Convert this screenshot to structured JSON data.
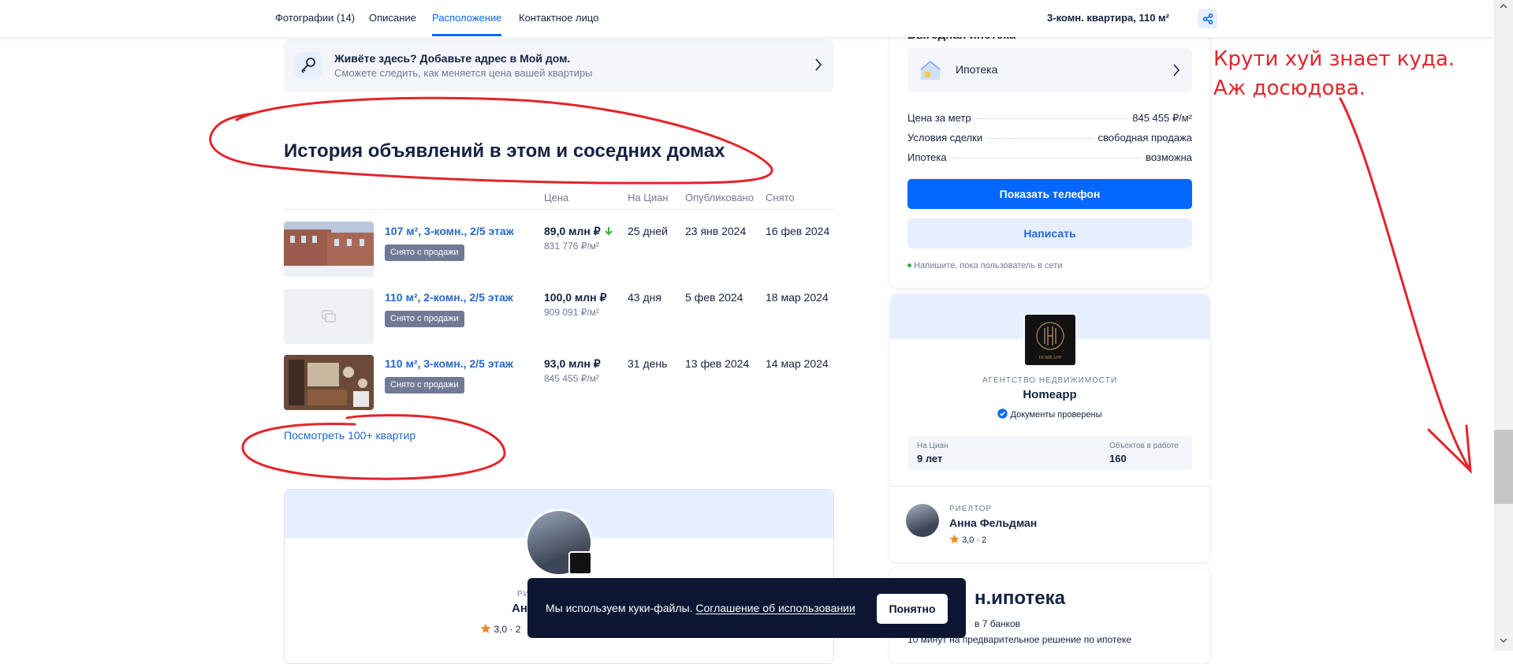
{
  "nav": {
    "tabs": [
      {
        "label": "Фотографии (14)"
      },
      {
        "label": "Описание"
      },
      {
        "label": "Расположение"
      },
      {
        "label": "Контактное лицо"
      }
    ],
    "active_tab": "Расположение",
    "summary": "3-комн. квартира, 110 м²"
  },
  "live_here": {
    "title": "Живёте здесь? Добавьте адрес в Мой дом.",
    "subtitle": "Сможете следить, как меняется цена вашей квартиры"
  },
  "history": {
    "title": "История объявлений в этом и соседних домах",
    "columns": [
      "Цена",
      "На Циан",
      "Опубликовано",
      "Снято"
    ],
    "rows": [
      {
        "title": "107 м², 3-комн., 2/5 этаж",
        "badge": "Снято с продажи",
        "price": "89,0 млн ₽",
        "ppm": "831 776 ₽/м²",
        "on_cian": "25 дней",
        "published": "23 янв 2024",
        "removed": "16 фев 2024"
      },
      {
        "title": "110 м², 2-комн., 2/5 этаж",
        "badge": "Снято с продажи",
        "price": "100,0 млн ₽",
        "ppm": "909 091 ₽/м²",
        "on_cian": "43 дня",
        "published": "5 фев 2024",
        "removed": "18 мар 2024"
      },
      {
        "title": "110 м², 3-комн., 2/5 этаж",
        "badge": "Снято с продажи",
        "price": "93,0 млн ₽",
        "ppm": "845 455 ₽/м²",
        "on_cian": "31 день",
        "published": "13 фев 2024",
        "removed": "14 мар 2024"
      }
    ],
    "more_link": "Посмотреть 100+ квартир"
  },
  "left_agent": {
    "role": "РИ",
    "name": "Ан",
    "rating": "3,0 · 2"
  },
  "sidebar": {
    "mortgage_heading": "Выгодная ипотека",
    "mortgage_item": "Ипотека",
    "details": [
      {
        "label": "Цена за метр",
        "value": "845 455 ₽/м²"
      },
      {
        "label": "Условия сделки",
        "value": "свободная продажа"
      },
      {
        "label": "Ипотека",
        "value": "возможна"
      }
    ],
    "show_phone": "Показать телефон",
    "write": "Написать",
    "online_hint": "Напишите, пока пользователь в сети",
    "agency": {
      "type": "АГЕНТСТВО НЕДВИЖИМОСТИ",
      "name": "Homeapp",
      "logo_text": "HOMEAPP",
      "verified": "Документы проверены",
      "stats": [
        {
          "label": "На Циан",
          "value": "9 лет"
        },
        {
          "label": "Объектов в работе",
          "value": "160"
        }
      ]
    },
    "realtor": {
      "role": "РИЕЛТОР",
      "name": "Анна Фельдман",
      "rating": "3,0 · 2"
    },
    "promo": {
      "title": "н.ипотека",
      "line1": "в 7 банков",
      "line2": "10 минут на предварительное решение по ипотеке"
    }
  },
  "cookie": {
    "text": "Мы используем куки-файлы.",
    "link": "Соглашение об использовании",
    "button": "Понятно"
  },
  "annotation": {
    "text": "Крути хуй знает куда. Аж досюдова."
  },
  "colors": {
    "accent": "#0468ff",
    "annotation": "#e4242a",
    "cookie_bg": "#0b1633",
    "badge_bg": "#707a95"
  }
}
